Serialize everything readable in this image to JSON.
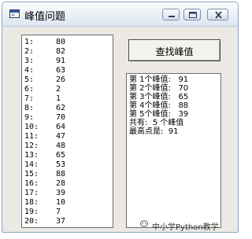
{
  "window": {
    "title": "峰值问题"
  },
  "list": {
    "items": [
      {
        "index": "1:",
        "value": "80"
      },
      {
        "index": "2:",
        "value": "82"
      },
      {
        "index": "3:",
        "value": "91"
      },
      {
        "index": "4:",
        "value": "63"
      },
      {
        "index": "5:",
        "value": "26"
      },
      {
        "index": "6:",
        "value": "2"
      },
      {
        "index": "7:",
        "value": "1"
      },
      {
        "index": "8:",
        "value": "62"
      },
      {
        "index": "9:",
        "value": "70"
      },
      {
        "index": "10:",
        "value": "64"
      },
      {
        "index": "11:",
        "value": "47"
      },
      {
        "index": "12:",
        "value": "48"
      },
      {
        "index": "13:",
        "value": "65"
      },
      {
        "index": "14:",
        "value": "53"
      },
      {
        "index": "15:",
        "value": "88"
      },
      {
        "index": "16:",
        "value": "28"
      },
      {
        "index": "17:",
        "value": "39"
      },
      {
        "index": "18:",
        "value": "10"
      },
      {
        "index": "19:",
        "value": "7"
      },
      {
        "index": "20:",
        "value": "37"
      }
    ]
  },
  "find_button": {
    "label": "查找峰值"
  },
  "results": {
    "lines": [
      "第 1个峰值:   91",
      "第 2个峰值:   70",
      "第 3个峰值:   65",
      "第 4个峰值:   88",
      "第 5个峰值:   39",
      "共有:  5 个峰值",
      "最高点是:  91"
    ]
  },
  "watermark": {
    "text": "中小学Python教学"
  },
  "icons": {
    "app": "form-icon",
    "minimize": "minimize-icon",
    "maximize": "maximize-icon",
    "close": "close-icon",
    "watermark": "wechat-icon"
  }
}
